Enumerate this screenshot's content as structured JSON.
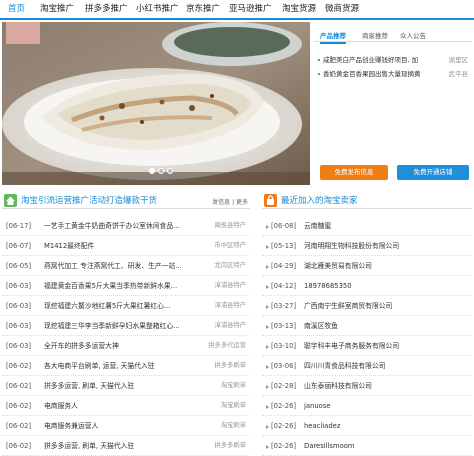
{
  "nav": {
    "items": [
      "首页",
      "淘宝推广",
      "拼多多推广",
      "小红书推广",
      "京东推广",
      "亚马逊推广",
      "淘宝货源",
      "微商货源"
    ]
  },
  "banner": {
    "dots": 3,
    "active_dot": 0
  },
  "panel": {
    "tabs": [
      "产品推荐",
      "商家推荐",
      "众人公告"
    ],
    "news": [
      {
        "title": "咸肥美白产品创业赚钱好项目, 加",
        "loc": "湖里区"
      },
      {
        "title": "香奶黄金百香果园出售大量现摘黄",
        "loc": "武平县"
      }
    ],
    "btn_apply": "免费发布信息",
    "btn_shop": "免费开通店铺"
  },
  "left_section": {
    "title": "淘宝引流运营推广活动打造爆款干货",
    "right_links": "发信息 | 更多",
    "rows": [
      {
        "date": "[06-17]",
        "title": "一艺手工黄金牛奶曲奇饼干办公室休闲食品...",
        "cat": "闽侯县特产"
      },
      {
        "date": "[06-07]",
        "title": "M1412最终配件",
        "cat": "市中区特产"
      },
      {
        "date": "[06-05]",
        "title": "燕窝代加工 专注燕窝代工、研发、生产一站...",
        "cat": "龙岗区特产"
      },
      {
        "date": "[06-03]",
        "title": "福建黄金百香果5斤大果当季热带新鲜水果...",
        "cat": "漳浦县特产"
      },
      {
        "date": "[06-03]",
        "title": "现挖福建六鳌沙地红薯5斤大果红薯红心...",
        "cat": "漳浦县特产"
      },
      {
        "date": "[06-03]",
        "title": "现挖福建三华李当季新鲜孕妇水果整箱红心...",
        "cat": "漳浦县特产"
      },
      {
        "date": "[06-03]",
        "title": "全开车的拼多多运营大神",
        "cat": "拼多多代运营"
      },
      {
        "date": "[06-02]",
        "title": "各大电商平台刷单, 运营, 天猫代入驻",
        "cat": "拼多多刷单"
      },
      {
        "date": "[06-02]",
        "title": "拼多多运营, 刷单, 天猫代入驻",
        "cat": "淘宝刷单"
      },
      {
        "date": "[06-02]",
        "title": "电商服务人",
        "cat": "淘宝刷单"
      },
      {
        "date": "[06-02]",
        "title": "电商服务兼运营人",
        "cat": "淘宝刷单"
      },
      {
        "date": "[06-02]",
        "title": "拼多多运营, 刷单, 天猫代入驻",
        "cat": "拼多多刷单"
      }
    ]
  },
  "right_section": {
    "title": "最近加入的淘宝卖家",
    "rows": [
      {
        "date": "[06-08]",
        "name": "云南糖蜜"
      },
      {
        "date": "[05-13]",
        "name": "河南明翔生物科技股份有限公司"
      },
      {
        "date": "[04-29]",
        "name": "湖北雁美贸易有限公司"
      },
      {
        "date": "[04-12]",
        "name": "18978685350"
      },
      {
        "date": "[03-27]",
        "name": "广西南宁生鲜室商贸有限公司"
      },
      {
        "date": "[03-13]",
        "name": "南溪区牧鱼"
      },
      {
        "date": "[03-10]",
        "name": "聪宇科丰电子商务服务有限公司"
      },
      {
        "date": "[03-06]",
        "name": "四川川青食品科技有限公司"
      },
      {
        "date": "[02-28]",
        "name": "山东泰丽科技有限公司"
      },
      {
        "date": "[02-26]",
        "name": "januose"
      },
      {
        "date": "[02-26]",
        "name": "heacliadez"
      },
      {
        "date": "[02-26]",
        "name": "Daresillsmoom"
      }
    ]
  },
  "colors": {
    "accent": "#1a8ad4",
    "orange": "#f07d15",
    "blue": "#1f8fd9",
    "green": "#5fb85a"
  }
}
